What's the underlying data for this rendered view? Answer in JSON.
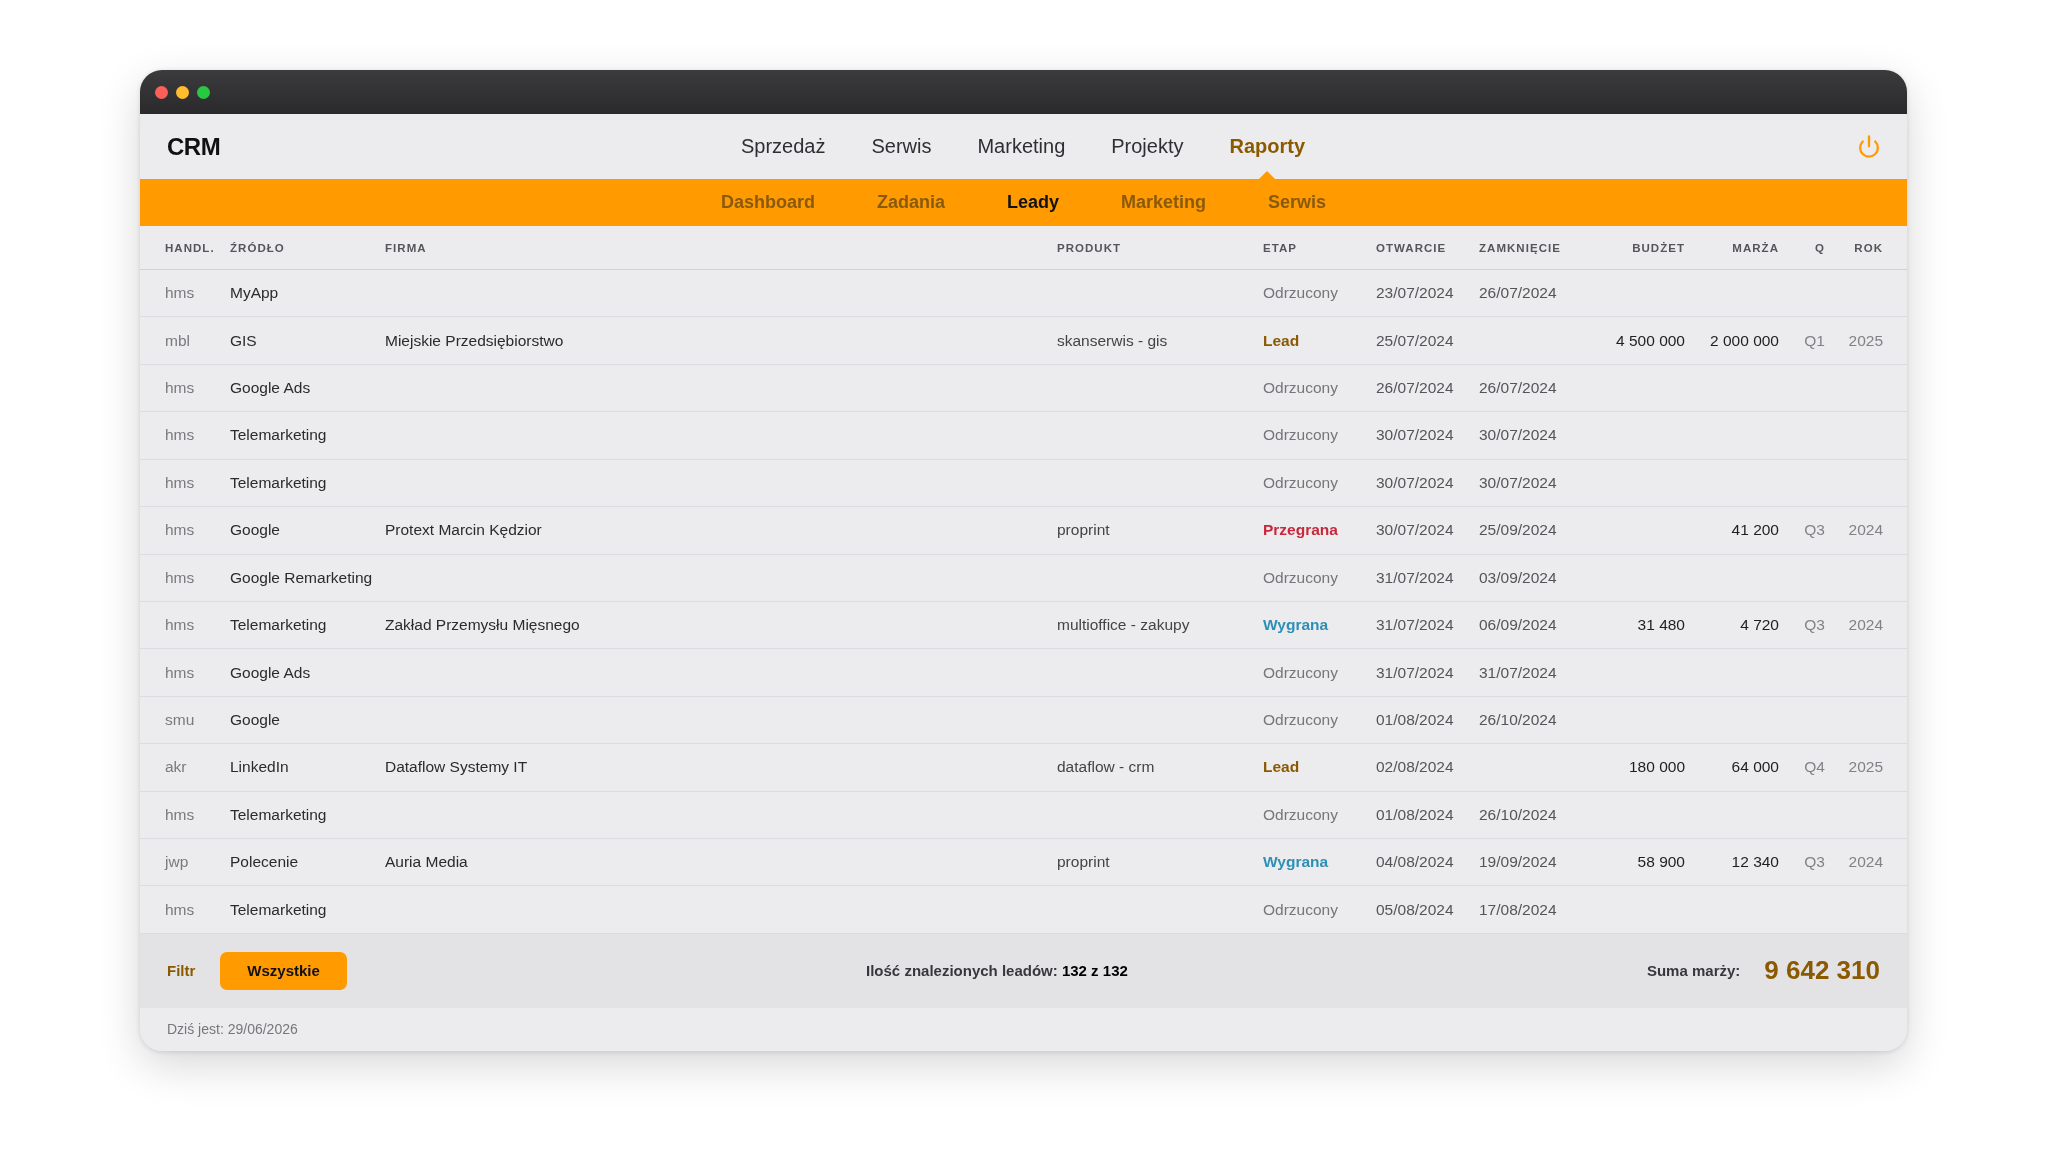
{
  "header": {
    "logo": "CRM",
    "nav": [
      {
        "label": "Sprzedaż",
        "selected": false
      },
      {
        "label": "Serwis",
        "selected": false
      },
      {
        "label": "Marketing",
        "selected": false
      },
      {
        "label": "Projekty",
        "selected": false
      },
      {
        "label": "Raporty",
        "selected": true
      }
    ]
  },
  "subnav": [
    {
      "label": "Dashboard",
      "selected": false
    },
    {
      "label": "Zadania",
      "selected": false
    },
    {
      "label": "Leady",
      "selected": true
    },
    {
      "label": "Marketing",
      "selected": false
    },
    {
      "label": "Serwis",
      "selected": false
    }
  ],
  "table": {
    "columns": [
      "HANDL.",
      "ŹRÓDŁO",
      "FIRMA",
      "PRODUKT",
      "ETAP",
      "OTWARCIE",
      "ZAMKNIĘCIE",
      "BUDŻET",
      "MARŻA",
      "Q",
      "ROK"
    ],
    "rows": [
      {
        "handler": "hms",
        "source": "MyApp",
        "stage": {
          "text": "Odrzucony",
          "kind": "rejected"
        },
        "opened": "23/07/2024",
        "closed": "26/07/2024"
      },
      {
        "handler": "mbl",
        "source": "GIS",
        "company": "Miejskie Przedsiębiorstwo",
        "product": "skanserwis - gis",
        "stage": {
          "text": "Lead",
          "kind": "lead"
        },
        "opened": "25/07/2024",
        "budget": "4 500 000",
        "margin": "2 000 000",
        "quarter": "Q1",
        "year": "2025"
      },
      {
        "handler": "hms",
        "source": "Google Ads",
        "stage": {
          "text": "Odrzucony",
          "kind": "rejected"
        },
        "opened": "26/07/2024",
        "closed": "26/07/2024"
      },
      {
        "handler": "hms",
        "source": "Telemarketing",
        "stage": {
          "text": "Odrzucony",
          "kind": "rejected"
        },
        "opened": "30/07/2024",
        "closed": "30/07/2024"
      },
      {
        "handler": "hms",
        "source": "Telemarketing",
        "stage": {
          "text": "Odrzucony",
          "kind": "rejected"
        },
        "opened": "30/07/2024",
        "closed": "30/07/2024"
      },
      {
        "handler": "hms",
        "source": "Google",
        "company": "Protext Marcin Kędzior",
        "product": "proprint",
        "stage": {
          "text": "Przegrana",
          "kind": "lost"
        },
        "opened": "30/07/2024",
        "closed": "25/09/2024",
        "margin": "41 200",
        "quarter": "Q3",
        "year": "2024"
      },
      {
        "handler": "hms",
        "source": "Google Remarketing",
        "stage": {
          "text": "Odrzucony",
          "kind": "rejected"
        },
        "opened": "31/07/2024",
        "closed": "03/09/2024"
      },
      {
        "handler": "hms",
        "source": "Telemarketing",
        "company": "Zakład Przemysłu Mięsnego",
        "product": "multioffice - zakupy",
        "stage": {
          "text": "Wygrana",
          "kind": "won"
        },
        "opened": "31/07/2024",
        "closed": "06/09/2024",
        "budget": "31 480",
        "margin": "4 720",
        "quarter": "Q3",
        "year": "2024"
      },
      {
        "handler": "hms",
        "source": "Google Ads",
        "stage": {
          "text": "Odrzucony",
          "kind": "rejected"
        },
        "opened": "31/07/2024",
        "closed": "31/07/2024"
      },
      {
        "handler": "smu",
        "source": "Google",
        "stage": {
          "text": "Odrzucony",
          "kind": "rejected"
        },
        "opened": "01/08/2024",
        "closed": "26/10/2024"
      },
      {
        "handler": "akr",
        "source": "LinkedIn",
        "company": "Dataflow Systemy IT",
        "product": "dataflow - crm",
        "stage": {
          "text": "Lead",
          "kind": "lead"
        },
        "opened": "02/08/2024",
        "budget": "180 000",
        "margin": "64 000",
        "quarter": "Q4",
        "year": "2025"
      },
      {
        "handler": "hms",
        "source": "Telemarketing",
        "stage": {
          "text": "Odrzucony",
          "kind": "rejected"
        },
        "opened": "01/08/2024",
        "closed": "26/10/2024"
      },
      {
        "handler": "jwp",
        "source": "Polecenie",
        "company": "Auria Media",
        "product": "proprint",
        "stage": {
          "text": "Wygrana",
          "kind": "won"
        },
        "opened": "04/08/2024",
        "closed": "19/09/2024",
        "budget": "58 900",
        "margin": "12 340",
        "quarter": "Q3",
        "year": "2024"
      },
      {
        "handler": "hms",
        "source": "Telemarketing",
        "stage": {
          "text": "Odrzucony",
          "kind": "rejected"
        },
        "opened": "05/08/2024",
        "closed": "17/08/2024"
      }
    ]
  },
  "footer": {
    "filter_label": "Filtr",
    "filter_button": "Wszystkie",
    "results": "Ilość znalezionych leadów: **132 z 132**",
    "sum_label": "Suma marży:",
    "sum_value": "9 642 310"
  },
  "status_bar": {
    "today": "Dziś jest: 29/06/2026"
  }
}
